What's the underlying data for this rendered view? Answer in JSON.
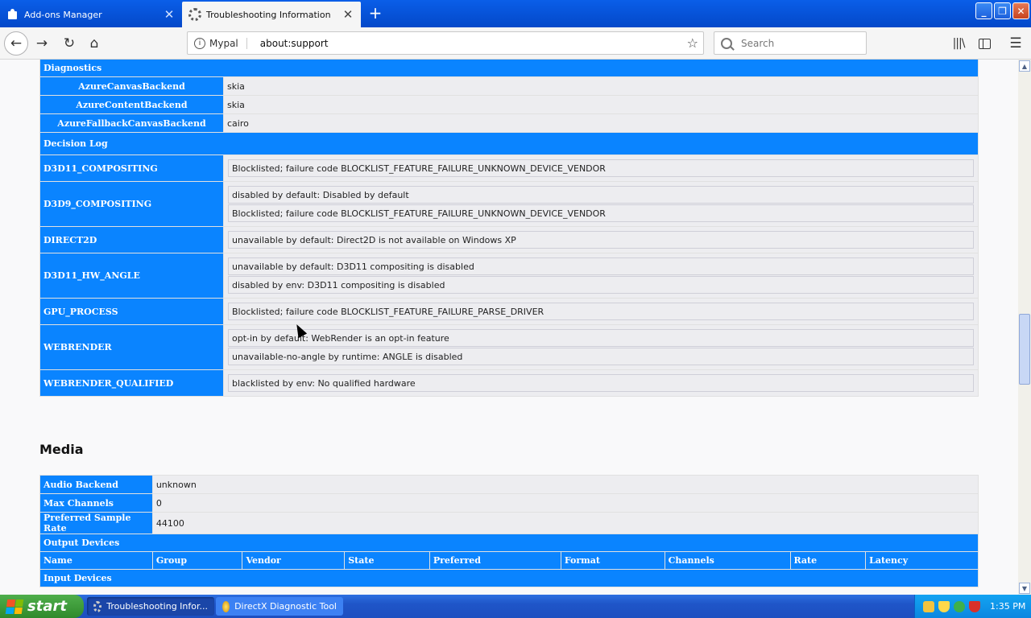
{
  "tabs": [
    {
      "title": "Add-ons Manager",
      "active": false,
      "icon": "puzzle-icon"
    },
    {
      "title": "Troubleshooting Information",
      "active": true,
      "icon": "gear-icon"
    }
  ],
  "navbar": {
    "identity": "Mypal",
    "url": "about:support",
    "search_placeholder": "Search"
  },
  "diagnostics": {
    "title": "Diagnostics",
    "rows": [
      {
        "key": "AzureCanvasBackend",
        "value": "skia"
      },
      {
        "key": "AzureContentBackend",
        "value": "skia"
      },
      {
        "key": "AzureFallbackCanvasBackend",
        "value": "cairo"
      }
    ]
  },
  "decision_log": {
    "title": "Decision Log",
    "rows": [
      {
        "key": "D3D11_COMPOSITING",
        "entries": [
          "Blocklisted; failure code BLOCKLIST_FEATURE_FAILURE_UNKNOWN_DEVICE_VENDOR"
        ]
      },
      {
        "key": "D3D9_COMPOSITING",
        "entries": [
          "disabled by default: Disabled by default",
          "Blocklisted; failure code BLOCKLIST_FEATURE_FAILURE_UNKNOWN_DEVICE_VENDOR"
        ]
      },
      {
        "key": "DIRECT2D",
        "entries": [
          "unavailable by default: Direct2D is not available on Windows XP"
        ]
      },
      {
        "key": "D3D11_HW_ANGLE",
        "entries": [
          "unavailable by default: D3D11 compositing is disabled",
          "disabled by env: D3D11 compositing is disabled"
        ]
      },
      {
        "key": "GPU_PROCESS",
        "entries": [
          "Blocklisted; failure code BLOCKLIST_FEATURE_FAILURE_PARSE_DRIVER"
        ]
      },
      {
        "key": "WEBRENDER",
        "entries": [
          "opt-in by default: WebRender is an opt-in feature",
          "unavailable-no-angle by runtime: ANGLE is disabled"
        ]
      },
      {
        "key": "WEBRENDER_QUALIFIED",
        "entries": [
          "blacklisted by env: No qualified hardware"
        ]
      }
    ]
  },
  "media": {
    "title": "Media",
    "rows": [
      {
        "key": "Audio Backend",
        "value": "unknown"
      },
      {
        "key": "Max Channels",
        "value": "0"
      },
      {
        "key": "Preferred Sample Rate",
        "value": "44100"
      }
    ],
    "output_devices_title": "Output Devices",
    "columns": [
      "Name",
      "Group",
      "Vendor",
      "State",
      "Preferred",
      "Format",
      "Channels",
      "Rate",
      "Latency"
    ],
    "input_devices_title": "Input Devices"
  },
  "taskbar": {
    "start_label": "start",
    "tasks": [
      {
        "label": "Troubleshooting Infor...",
        "active": true
      },
      {
        "label": "DirectX Diagnostic Tool",
        "active": false
      }
    ],
    "clock": "1:35 PM"
  },
  "colors": {
    "accent": "#0a84ff",
    "titlebar": "#0348c9",
    "start": "#2f8a2b"
  }
}
